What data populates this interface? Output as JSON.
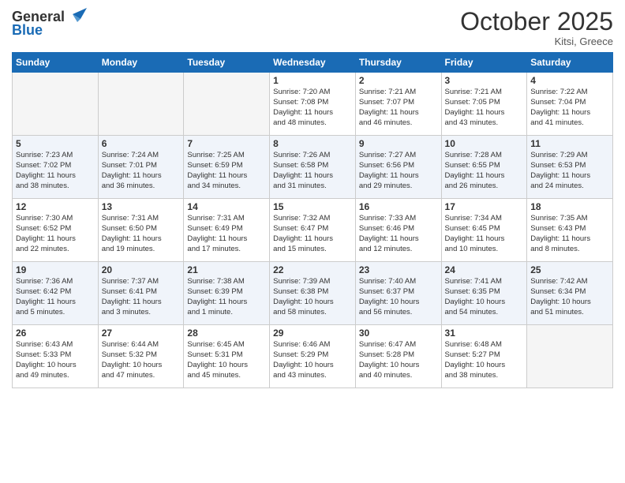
{
  "header": {
    "logo_line1": "General",
    "logo_line2": "Blue",
    "month": "October 2025",
    "location": "Kitsi, Greece"
  },
  "days_of_week": [
    "Sunday",
    "Monday",
    "Tuesday",
    "Wednesday",
    "Thursday",
    "Friday",
    "Saturday"
  ],
  "weeks": [
    {
      "row_class": "row-white",
      "days": [
        {
          "num": "",
          "info": "",
          "empty": true
        },
        {
          "num": "",
          "info": "",
          "empty": true
        },
        {
          "num": "",
          "info": "",
          "empty": true
        },
        {
          "num": "1",
          "info": "Sunrise: 7:20 AM\nSunset: 7:08 PM\nDaylight: 11 hours\nand 48 minutes.",
          "empty": false
        },
        {
          "num": "2",
          "info": "Sunrise: 7:21 AM\nSunset: 7:07 PM\nDaylight: 11 hours\nand 46 minutes.",
          "empty": false
        },
        {
          "num": "3",
          "info": "Sunrise: 7:21 AM\nSunset: 7:05 PM\nDaylight: 11 hours\nand 43 minutes.",
          "empty": false
        },
        {
          "num": "4",
          "info": "Sunrise: 7:22 AM\nSunset: 7:04 PM\nDaylight: 11 hours\nand 41 minutes.",
          "empty": false
        }
      ]
    },
    {
      "row_class": "row-blue",
      "days": [
        {
          "num": "5",
          "info": "Sunrise: 7:23 AM\nSunset: 7:02 PM\nDaylight: 11 hours\nand 38 minutes.",
          "empty": false
        },
        {
          "num": "6",
          "info": "Sunrise: 7:24 AM\nSunset: 7:01 PM\nDaylight: 11 hours\nand 36 minutes.",
          "empty": false
        },
        {
          "num": "7",
          "info": "Sunrise: 7:25 AM\nSunset: 6:59 PM\nDaylight: 11 hours\nand 34 minutes.",
          "empty": false
        },
        {
          "num": "8",
          "info": "Sunrise: 7:26 AM\nSunset: 6:58 PM\nDaylight: 11 hours\nand 31 minutes.",
          "empty": false
        },
        {
          "num": "9",
          "info": "Sunrise: 7:27 AM\nSunset: 6:56 PM\nDaylight: 11 hours\nand 29 minutes.",
          "empty": false
        },
        {
          "num": "10",
          "info": "Sunrise: 7:28 AM\nSunset: 6:55 PM\nDaylight: 11 hours\nand 26 minutes.",
          "empty": false
        },
        {
          "num": "11",
          "info": "Sunrise: 7:29 AM\nSunset: 6:53 PM\nDaylight: 11 hours\nand 24 minutes.",
          "empty": false
        }
      ]
    },
    {
      "row_class": "row-white",
      "days": [
        {
          "num": "12",
          "info": "Sunrise: 7:30 AM\nSunset: 6:52 PM\nDaylight: 11 hours\nand 22 minutes.",
          "empty": false
        },
        {
          "num": "13",
          "info": "Sunrise: 7:31 AM\nSunset: 6:50 PM\nDaylight: 11 hours\nand 19 minutes.",
          "empty": false
        },
        {
          "num": "14",
          "info": "Sunrise: 7:31 AM\nSunset: 6:49 PM\nDaylight: 11 hours\nand 17 minutes.",
          "empty": false
        },
        {
          "num": "15",
          "info": "Sunrise: 7:32 AM\nSunset: 6:47 PM\nDaylight: 11 hours\nand 15 minutes.",
          "empty": false
        },
        {
          "num": "16",
          "info": "Sunrise: 7:33 AM\nSunset: 6:46 PM\nDaylight: 11 hours\nand 12 minutes.",
          "empty": false
        },
        {
          "num": "17",
          "info": "Sunrise: 7:34 AM\nSunset: 6:45 PM\nDaylight: 11 hours\nand 10 minutes.",
          "empty": false
        },
        {
          "num": "18",
          "info": "Sunrise: 7:35 AM\nSunset: 6:43 PM\nDaylight: 11 hours\nand 8 minutes.",
          "empty": false
        }
      ]
    },
    {
      "row_class": "row-blue",
      "days": [
        {
          "num": "19",
          "info": "Sunrise: 7:36 AM\nSunset: 6:42 PM\nDaylight: 11 hours\nand 5 minutes.",
          "empty": false
        },
        {
          "num": "20",
          "info": "Sunrise: 7:37 AM\nSunset: 6:41 PM\nDaylight: 11 hours\nand 3 minutes.",
          "empty": false
        },
        {
          "num": "21",
          "info": "Sunrise: 7:38 AM\nSunset: 6:39 PM\nDaylight: 11 hours\nand 1 minute.",
          "empty": false
        },
        {
          "num": "22",
          "info": "Sunrise: 7:39 AM\nSunset: 6:38 PM\nDaylight: 10 hours\nand 58 minutes.",
          "empty": false
        },
        {
          "num": "23",
          "info": "Sunrise: 7:40 AM\nSunset: 6:37 PM\nDaylight: 10 hours\nand 56 minutes.",
          "empty": false
        },
        {
          "num": "24",
          "info": "Sunrise: 7:41 AM\nSunset: 6:35 PM\nDaylight: 10 hours\nand 54 minutes.",
          "empty": false
        },
        {
          "num": "25",
          "info": "Sunrise: 7:42 AM\nSunset: 6:34 PM\nDaylight: 10 hours\nand 51 minutes.",
          "empty": false
        }
      ]
    },
    {
      "row_class": "row-white",
      "days": [
        {
          "num": "26",
          "info": "Sunrise: 6:43 AM\nSunset: 5:33 PM\nDaylight: 10 hours\nand 49 minutes.",
          "empty": false
        },
        {
          "num": "27",
          "info": "Sunrise: 6:44 AM\nSunset: 5:32 PM\nDaylight: 10 hours\nand 47 minutes.",
          "empty": false
        },
        {
          "num": "28",
          "info": "Sunrise: 6:45 AM\nSunset: 5:31 PM\nDaylight: 10 hours\nand 45 minutes.",
          "empty": false
        },
        {
          "num": "29",
          "info": "Sunrise: 6:46 AM\nSunset: 5:29 PM\nDaylight: 10 hours\nand 43 minutes.",
          "empty": false
        },
        {
          "num": "30",
          "info": "Sunrise: 6:47 AM\nSunset: 5:28 PM\nDaylight: 10 hours\nand 40 minutes.",
          "empty": false
        },
        {
          "num": "31",
          "info": "Sunrise: 6:48 AM\nSunset: 5:27 PM\nDaylight: 10 hours\nand 38 minutes.",
          "empty": false
        },
        {
          "num": "",
          "info": "",
          "empty": true
        }
      ]
    }
  ]
}
